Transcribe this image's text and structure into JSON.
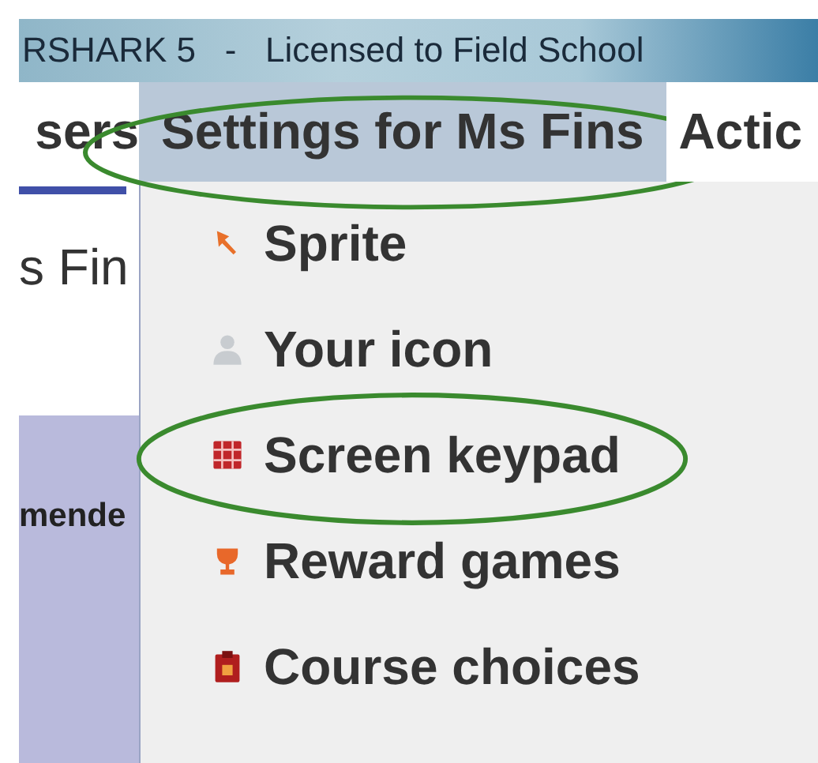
{
  "window": {
    "title": "RSHARK 5   -   Licensed to Field School"
  },
  "menu_bar": [
    {
      "label": "sers",
      "selected": false,
      "circled": false
    },
    {
      "label": "Settings for Ms Fins",
      "selected": true,
      "circled": true
    },
    {
      "label": "Actic",
      "selected": false,
      "circled": false
    }
  ],
  "side_panel": {
    "name": "s Fin",
    "label": "mende"
  },
  "menu": [
    {
      "kind": "cursor",
      "label": "Sprite",
      "circled": false
    },
    {
      "kind": "person",
      "label": "Your icon",
      "circled": false
    },
    {
      "kind": "keypad",
      "label": "Screen keypad",
      "circled": true
    },
    {
      "kind": "trophy",
      "label": "Reward games",
      "circled": false
    },
    {
      "kind": "book",
      "label": "Course choices",
      "circled": false
    }
  ]
}
